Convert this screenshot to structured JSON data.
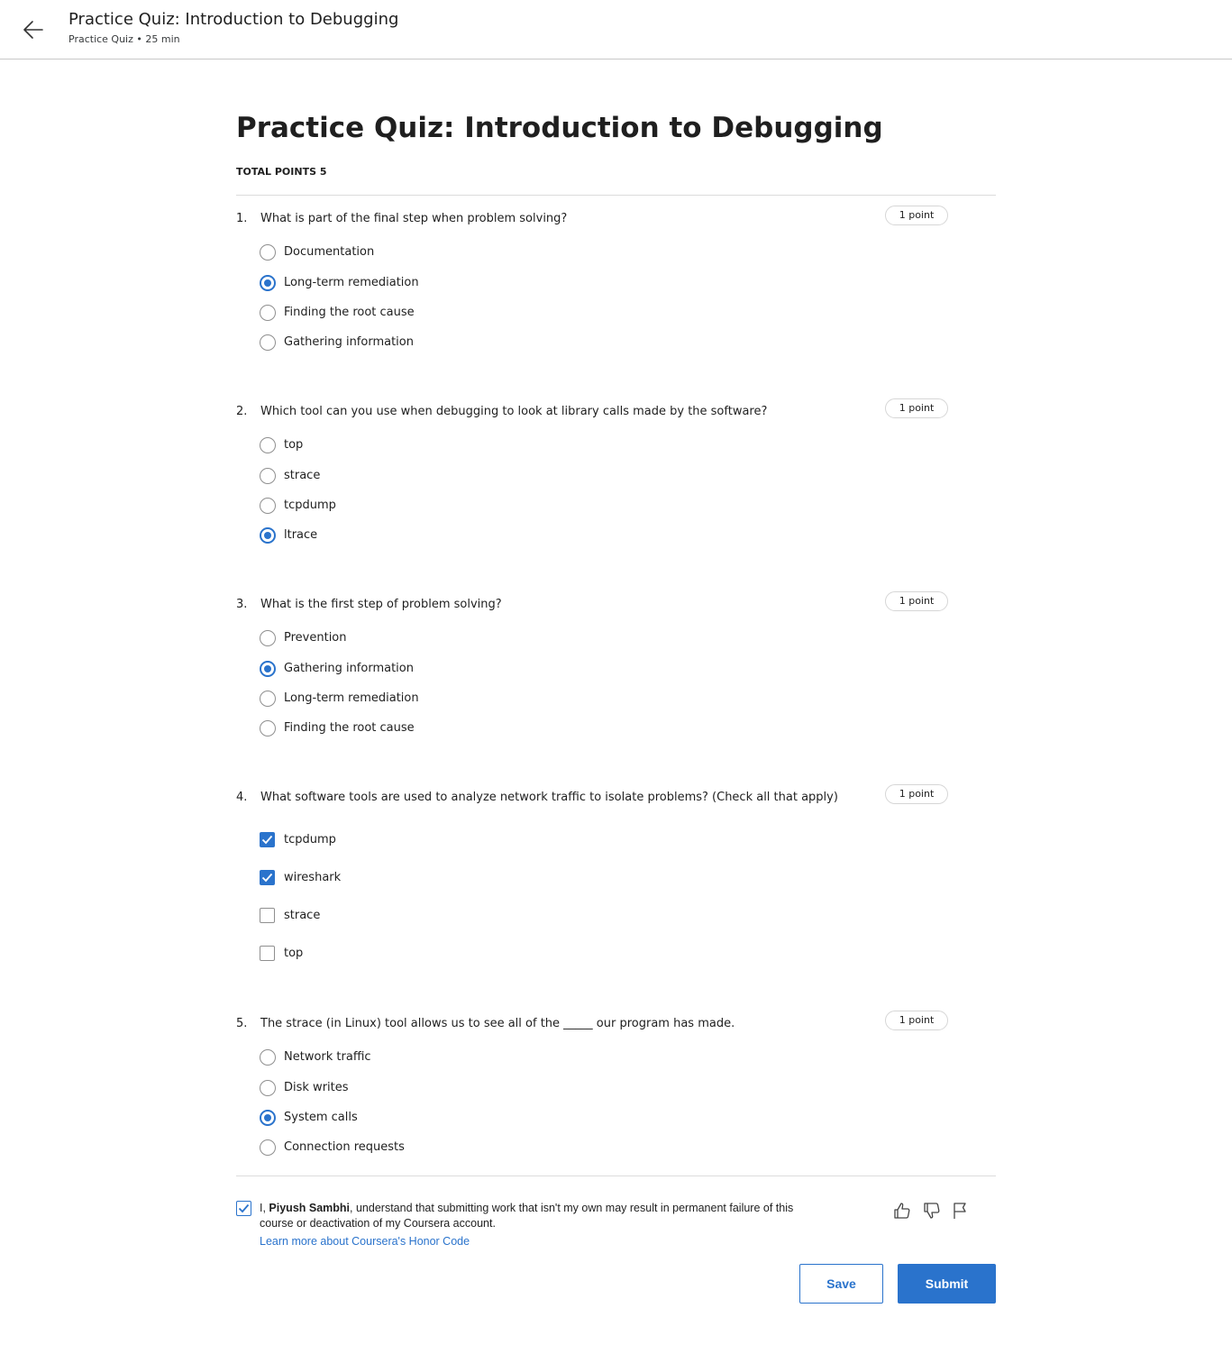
{
  "header": {
    "title": "Practice Quiz: Introduction to Debugging",
    "subtitle": "Practice Quiz • 25 min",
    "back_icon": "arrow-left-icon"
  },
  "quiz": {
    "title": "Practice Quiz: Introduction to Debugging",
    "total_points": "TOTAL POINTS 5"
  },
  "questions": [
    {
      "number": "1.",
      "text": "What is part of the final step when problem solving?",
      "points": "1 point",
      "type": "radio",
      "options": [
        {
          "label": "Documentation",
          "selected": false
        },
        {
          "label": "Long-term remediation",
          "selected": true
        },
        {
          "label": "Finding the root cause",
          "selected": false
        },
        {
          "label": "Gathering information",
          "selected": false
        }
      ]
    },
    {
      "number": "2.",
      "text": "Which tool can you use when debugging to look at library calls made by the software?",
      "points": "1 point",
      "type": "radio",
      "options": [
        {
          "label": "top",
          "selected": false
        },
        {
          "label": "strace",
          "selected": false
        },
        {
          "label": "tcpdump",
          "selected": false
        },
        {
          "label": "ltrace",
          "selected": true
        }
      ]
    },
    {
      "number": "3.",
      "text": "What is the first step of problem solving?",
      "points": "1 point",
      "type": "radio",
      "options": [
        {
          "label": "Prevention",
          "selected": false
        },
        {
          "label": "Gathering information",
          "selected": true
        },
        {
          "label": "Long-term remediation",
          "selected": false
        },
        {
          "label": "Finding the root cause",
          "selected": false
        }
      ]
    },
    {
      "number": "4.",
      "text": "What software tools are used to analyze network traffic to isolate problems? (Check all that apply)",
      "points": "1 point",
      "type": "checkbox",
      "options": [
        {
          "label": "tcpdump",
          "selected": true
        },
        {
          "label": "wireshark",
          "selected": true
        },
        {
          "label": "strace",
          "selected": false
        },
        {
          "label": "top",
          "selected": false
        }
      ]
    },
    {
      "number": "5.",
      "text": "The strace (in Linux) tool allows us to see all of the _____ our program has made.",
      "points": "1 point",
      "type": "radio",
      "options": [
        {
          "label": "Network traffic",
          "selected": false
        },
        {
          "label": "Disk writes",
          "selected": false
        },
        {
          "label": "System calls",
          "selected": true
        },
        {
          "label": "Connection requests",
          "selected": false
        }
      ]
    }
  ],
  "honor_code": {
    "checked": true,
    "prefix": "I, ",
    "name": "Piyush Sambhi",
    "suffix": ", understand that submitting work that isn't my own may result in permanent failure of this course or deactivation of my Coursera account.",
    "link": "Learn more about Coursera's Honor Code"
  },
  "feedback_icons": [
    "thumbs-up-icon",
    "thumbs-down-icon",
    "flag-icon"
  ],
  "actions": {
    "save": "Save",
    "submit": "Submit"
  },
  "colors": {
    "accent": "#2a73cc",
    "text": "#1f1f1f",
    "border": "#dcdcdc"
  }
}
